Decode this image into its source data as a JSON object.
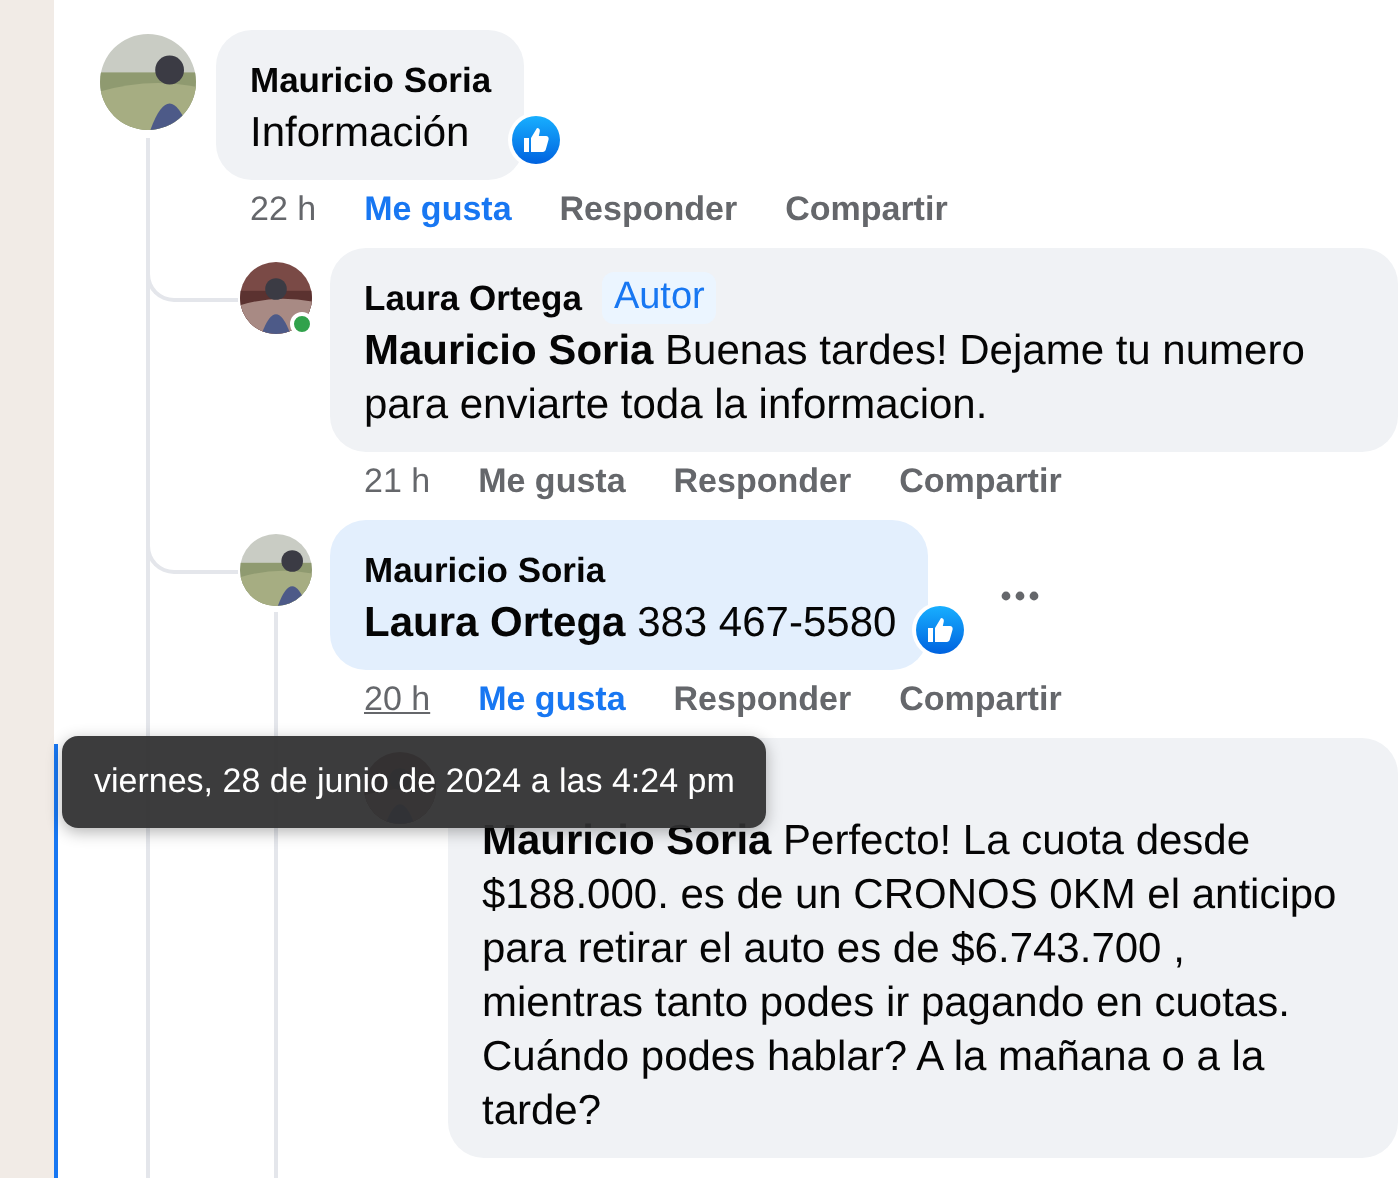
{
  "comments": [
    {
      "author": "Mauricio Soria",
      "text": "Información",
      "reacted": true,
      "time": "22 h",
      "time_hovered": false,
      "liked": true,
      "actions": [
        "Me gusta",
        "Responder",
        "Compartir"
      ],
      "highlighted": false,
      "replies": [
        {
          "author": "Laura Ortega",
          "badge": "Autor",
          "online": true,
          "mention": "Mauricio Soria",
          "text": "Buenas tardes! Dejame tu numero para enviarte toda la informacion.",
          "time": "21 h",
          "time_hovered": false,
          "liked": false,
          "actions": [
            "Me gusta",
            "Responder",
            "Compartir"
          ],
          "highlighted": false
        },
        {
          "author": "Mauricio Soria",
          "mention": "Laura Ortega",
          "text": "383 467-5580",
          "reacted": true,
          "time": "20 h",
          "time_hovered": true,
          "liked": true,
          "actions": [
            "Me gusta",
            "Responder",
            "Compartir"
          ],
          "highlighted": true,
          "show_menu": true,
          "replies": [
            {
              "mention": "Mauricio Soria",
              "text": "Perfecto! La cuota desde $188.000. es de un CRONOS 0KM el anticipo para retirar el auto es de $6.743.700 , mientras tanto podes ir pagando en cuotas. Cuándo podes hablar? A la mañana o a la tarde?",
              "highlighted": false
            }
          ]
        }
      ]
    }
  ],
  "tooltip": {
    "text": "viernes, 28 de junio de 2024 a las 4:24 pm"
  }
}
